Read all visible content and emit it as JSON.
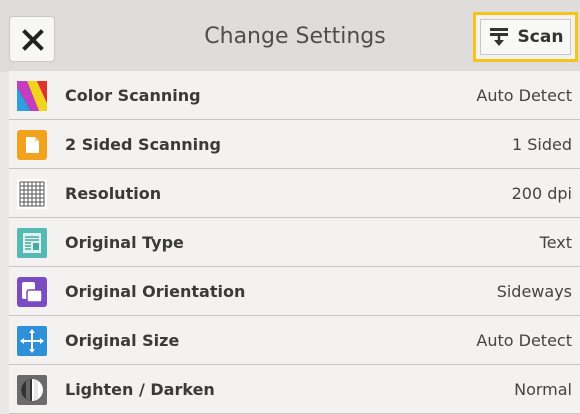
{
  "header": {
    "title": "Change Settings",
    "close_icon": "close-icon",
    "scan_label": "Scan",
    "scan_icon": "scan-icon",
    "highlight_color": "#f6c31c"
  },
  "settings": [
    {
      "label": "Color Scanning",
      "value": "Auto Detect",
      "icon": "color-scanning-icon"
    },
    {
      "label": "2 Sided Scanning",
      "value": "1 Sided",
      "icon": "two-sided-icon"
    },
    {
      "label": "Resolution",
      "value": "200 dpi",
      "icon": "resolution-icon"
    },
    {
      "label": "Original Type",
      "value": "Text",
      "icon": "original-type-icon"
    },
    {
      "label": "Original Orientation",
      "value": "Sideways",
      "icon": "orientation-icon"
    },
    {
      "label": "Original Size",
      "value": "Auto Detect",
      "icon": "original-size-icon"
    },
    {
      "label": "Lighten / Darken",
      "value": "Normal",
      "icon": "lighten-darken-icon"
    }
  ]
}
